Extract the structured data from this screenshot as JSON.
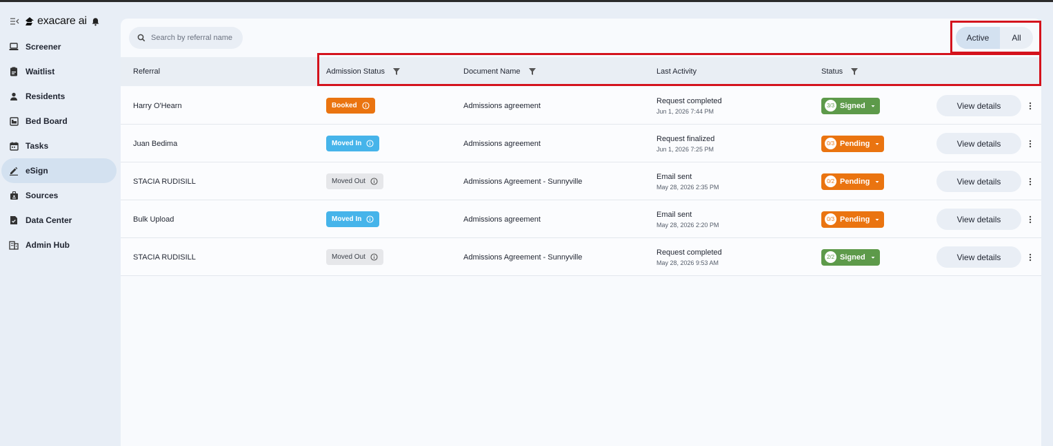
{
  "app": {
    "brand": "exacare ai"
  },
  "sidebar": {
    "items": [
      {
        "label": "Screener",
        "icon": "laptop-icon"
      },
      {
        "label": "Waitlist",
        "icon": "clipboard-icon"
      },
      {
        "label": "Residents",
        "icon": "person-icon"
      },
      {
        "label": "Bed Board",
        "icon": "bed-icon"
      },
      {
        "label": "Tasks",
        "icon": "calendar-icon"
      },
      {
        "label": "eSign",
        "icon": "pen-icon",
        "active": true
      },
      {
        "label": "Sources",
        "icon": "badge-icon"
      },
      {
        "label": "Data Center",
        "icon": "document-icon"
      },
      {
        "label": "Admin Hub",
        "icon": "building-icon"
      }
    ]
  },
  "search": {
    "placeholder": "Search by referral name"
  },
  "toggle": {
    "active_label": "Active",
    "all_label": "All",
    "selected": "Active"
  },
  "table": {
    "headers": {
      "referral": "Referral",
      "admission_status": "Admission Status",
      "document_name": "Document Name",
      "last_activity": "Last Activity",
      "status": "Status"
    },
    "rows": [
      {
        "referral": "Harry O'Hearn",
        "admission": "Booked",
        "admission_type": "booked",
        "document": "Admissions agreement",
        "activity": "Request completed",
        "activity_time": "Jun 1, 2026 7:44 PM",
        "fraction": "3/3",
        "status": "Signed",
        "status_type": "signed",
        "action": "View details"
      },
      {
        "referral": "Juan Bedima",
        "admission": "Moved In",
        "admission_type": "movedin",
        "document": "Admissions agreement",
        "activity": "Request finalized",
        "activity_time": "Jun 1, 2026 7:25 PM",
        "fraction": "0/3",
        "status": "Pending",
        "status_type": "pending",
        "action": "View details"
      },
      {
        "referral": "STACIA RUDISILL",
        "admission": "Moved Out",
        "admission_type": "movedout",
        "document": "Admissions Agreement - Sunnyville",
        "activity": "Email sent",
        "activity_time": "May 28, 2026 2:35 PM",
        "fraction": "0/2",
        "status": "Pending",
        "status_type": "pending",
        "action": "View details"
      },
      {
        "referral": "Bulk Upload",
        "admission": "Moved In",
        "admission_type": "movedin",
        "document": "Admissions agreement",
        "activity": "Email sent",
        "activity_time": "May 28, 2026 2:20 PM",
        "fraction": "0/3",
        "status": "Pending",
        "status_type": "pending",
        "action": "View details"
      },
      {
        "referral": "STACIA RUDISILL",
        "admission": "Moved Out",
        "admission_type": "movedout",
        "document": "Admissions Agreement - Sunnyville",
        "activity": "Request completed",
        "activity_time": "May 28, 2026 9:53 AM",
        "fraction": "2/2",
        "status": "Signed",
        "status_type": "signed",
        "action": "View details"
      }
    ]
  },
  "colors": {
    "booked": "#ea7410",
    "moved_in": "#46b4ea",
    "moved_out": "#e6e7ea",
    "signed": "#5d9a4a",
    "pending": "#ea7410",
    "highlight_frame": "#d4121c"
  }
}
